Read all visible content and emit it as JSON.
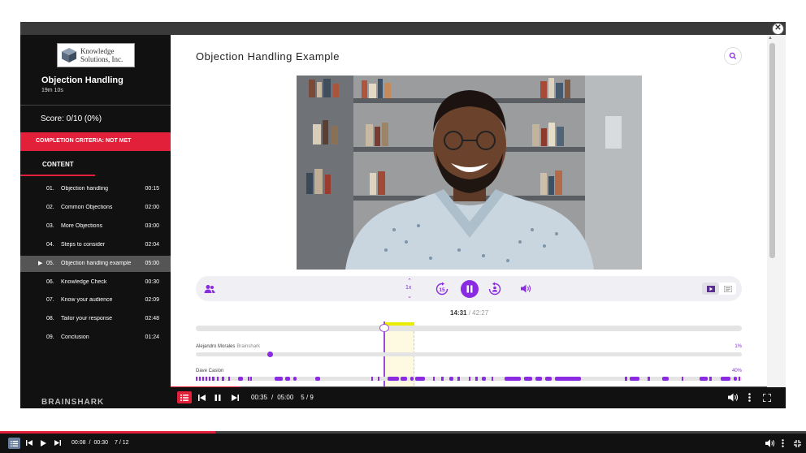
{
  "sidebar": {
    "logo_line1": "Knowledge",
    "logo_line2": "Solutions, Inc.",
    "course_title": "Objection Handling",
    "course_duration": "19m 10s",
    "score": "Score: 0/10 (0%)",
    "criteria": "COMPLETION CRITERIA: NOT MET",
    "content_label": "CONTENT",
    "brand": "BRAINSHARK",
    "items": [
      {
        "num": "01.",
        "title": "Objection handling",
        "time": "00:15"
      },
      {
        "num": "02.",
        "title": "Common Objections",
        "time": "02:00"
      },
      {
        "num": "03.",
        "title": "More Objections",
        "time": "03:00"
      },
      {
        "num": "04.",
        "title": "Steps to consider",
        "time": "02:04"
      },
      {
        "num": "05.",
        "title": "Objection handling example",
        "time": "05:00"
      },
      {
        "num": "06.",
        "title": "Knowledge Check",
        "time": "00:30"
      },
      {
        "num": "07.",
        "title": "Know your audience",
        "time": "02:09"
      },
      {
        "num": "08.",
        "title": "Tailor your response",
        "time": "02:48"
      },
      {
        "num": "09.",
        "title": "Conclusion",
        "time": "01:24"
      }
    ],
    "active_index": 4
  },
  "panel": {
    "title": "Objection Handling Example",
    "rate": "1x",
    "time_current": "14:31",
    "time_total": "/ 42:27",
    "progress": 0.345,
    "viewers": [
      {
        "name": "Alejandro Morales",
        "org": "Brainshark",
        "percent": "1%"
      },
      {
        "name": "Dave Casion",
        "org": "",
        "percent": "40%"
      }
    ]
  },
  "player": {
    "current": "00:35",
    "sep": "/",
    "duration": "05:00",
    "slide": "5 / 9",
    "progress": 0.117
  },
  "outer_player": {
    "current": "00:08",
    "sep": "/",
    "duration": "00:30",
    "slide": "7 / 12",
    "progress": 0.267
  },
  "colors": {
    "accent_red": "#e2203a",
    "accent_purple": "#8a2be2",
    "highlight_yellow": "#ecec00"
  }
}
